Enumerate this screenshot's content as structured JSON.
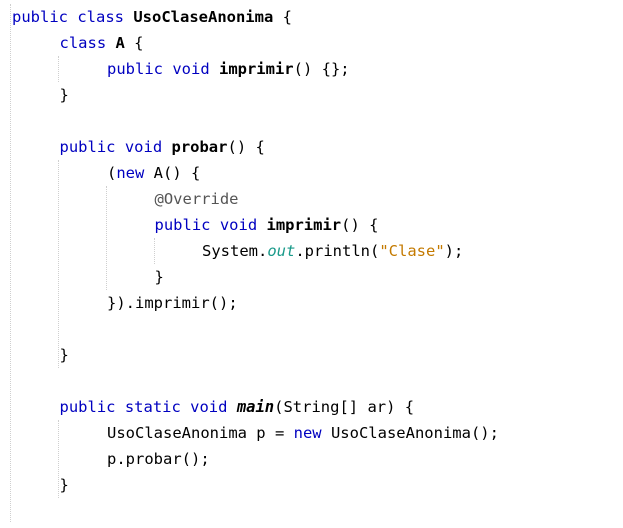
{
  "editor": {
    "lines": [
      {
        "indent": 0,
        "tokens": [
          {
            "t": "public class ",
            "c": "kw"
          },
          {
            "t": "UsoClaseAnonima",
            "c": "bold"
          },
          {
            "t": " {",
            "c": "plain"
          }
        ]
      },
      {
        "indent": 1,
        "tokens": [
          {
            "t": "class ",
            "c": "kw"
          },
          {
            "t": "A",
            "c": "bold"
          },
          {
            "t": " {",
            "c": "plain"
          }
        ]
      },
      {
        "indent": 2,
        "tokens": [
          {
            "t": "public void ",
            "c": "kw"
          },
          {
            "t": "imprimir",
            "c": "bold"
          },
          {
            "t": "() {};",
            "c": "plain"
          }
        ]
      },
      {
        "indent": 1,
        "tokens": [
          {
            "t": "}",
            "c": "plain"
          }
        ]
      },
      {
        "indent": 0,
        "tokens": []
      },
      {
        "indent": 1,
        "tokens": [
          {
            "t": "public void ",
            "c": "kw"
          },
          {
            "t": "probar",
            "c": "bold"
          },
          {
            "t": "() {",
            "c": "plain"
          }
        ]
      },
      {
        "indent": 2,
        "tokens": [
          {
            "t": "(",
            "c": "plain"
          },
          {
            "t": "new",
            "c": "kw"
          },
          {
            "t": " A() {",
            "c": "plain"
          }
        ]
      },
      {
        "indent": 3,
        "tokens": [
          {
            "t": "@Override",
            "c": "annot"
          }
        ]
      },
      {
        "indent": 3,
        "tokens": [
          {
            "t": "public void ",
            "c": "kw"
          },
          {
            "t": "imprimir",
            "c": "bold"
          },
          {
            "t": "() {",
            "c": "plain"
          }
        ]
      },
      {
        "indent": 4,
        "tokens": [
          {
            "t": "System.",
            "c": "plain"
          },
          {
            "t": "out",
            "c": "field"
          },
          {
            "t": ".println(",
            "c": "plain"
          },
          {
            "t": "\"Clase\"",
            "c": "str"
          },
          {
            "t": ");",
            "c": "plain"
          }
        ]
      },
      {
        "indent": 3,
        "tokens": [
          {
            "t": "}",
            "c": "plain"
          }
        ]
      },
      {
        "indent": 2,
        "tokens": [
          {
            "t": "}).imprimir();",
            "c": "plain"
          }
        ]
      },
      {
        "indent": 0,
        "tokens": []
      },
      {
        "indent": 1,
        "tokens": [
          {
            "t": "}",
            "c": "plain"
          }
        ]
      },
      {
        "indent": 0,
        "tokens": []
      },
      {
        "indent": 1,
        "tokens": [
          {
            "t": "public static void ",
            "c": "kw"
          },
          {
            "t": "main",
            "c": "bolditalic"
          },
          {
            "t": "(String[] ar) {",
            "c": "plain"
          }
        ]
      },
      {
        "indent": 2,
        "tokens": [
          {
            "t": "UsoClaseAnonima p = ",
            "c": "plain"
          },
          {
            "t": "new",
            "c": "kw"
          },
          {
            "t": " UsoClaseAnonima();",
            "c": "plain"
          }
        ]
      },
      {
        "indent": 2,
        "tokens": [
          {
            "t": "p.probar();",
            "c": "plain"
          }
        ]
      },
      {
        "indent": 1,
        "tokens": [
          {
            "t": "}",
            "c": "plain"
          }
        ]
      }
    ]
  },
  "colors": {
    "keyword": "#0000c0",
    "string": "#c47a00",
    "field": "#1a9a8a",
    "annotation": "#555555",
    "text": "#000000",
    "background": "#ffffff"
  }
}
